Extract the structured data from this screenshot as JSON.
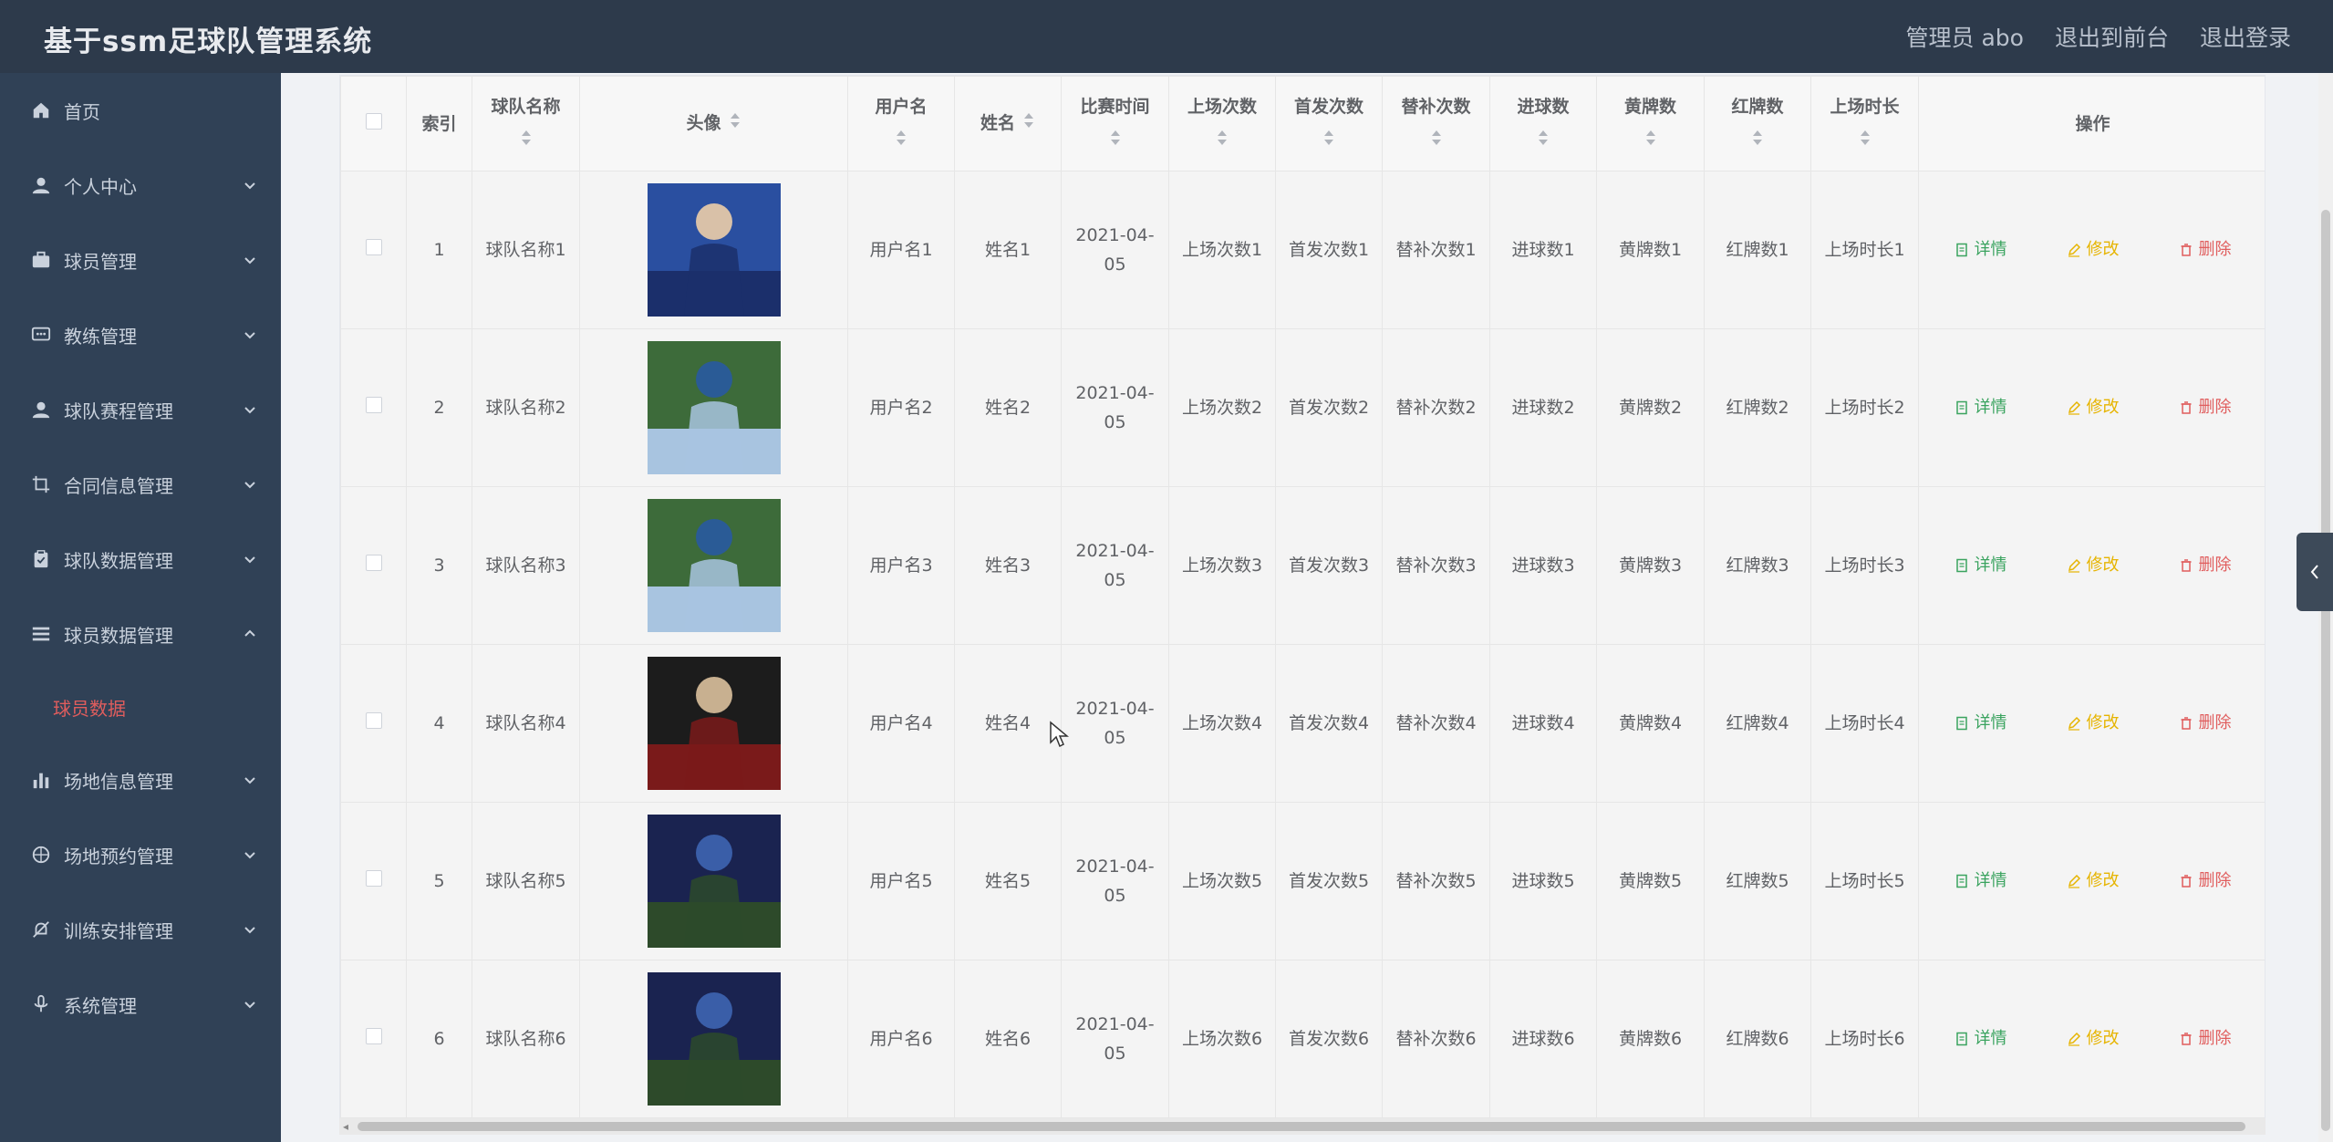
{
  "header": {
    "title": "基于ssm足球队管理系统",
    "admin_label": "管理员 abo",
    "front_label": "退出到前台",
    "logout_label": "退出登录"
  },
  "sidebar": {
    "items": [
      {
        "label": "首页",
        "icon": "home-icon"
      },
      {
        "label": "个人中心",
        "icon": "user-icon"
      },
      {
        "label": "球员管理",
        "icon": "briefcase-icon"
      },
      {
        "label": "教练管理",
        "icon": "chat-icon"
      },
      {
        "label": "球队赛程管理",
        "icon": "user-icon"
      },
      {
        "label": "合同信息管理",
        "icon": "crop-icon"
      },
      {
        "label": "球队数据管理",
        "icon": "clipboard-icon"
      },
      {
        "label": "球员数据管理",
        "icon": "list-icon"
      },
      {
        "label": "场地信息管理",
        "icon": "bar-chart-icon"
      },
      {
        "label": "场地预约管理",
        "icon": "globe-icon"
      },
      {
        "label": "训练安排管理",
        "icon": "bell-off-icon"
      },
      {
        "label": "系统管理",
        "icon": "mic-icon"
      }
    ],
    "active_sub": "球员数据"
  },
  "table": {
    "headers": {
      "index": "索引",
      "team": "球队名称",
      "avatar": "头像",
      "username": "用户名",
      "name": "姓名",
      "match_time": "比赛时间",
      "appearances": "上场次数",
      "starts": "首发次数",
      "subs": "替补次数",
      "goals": "进球数",
      "yellow": "黄牌数",
      "red": "红牌数",
      "minutes": "上场时长",
      "ops": "操作"
    },
    "ops": {
      "detail": "详情",
      "edit": "修改",
      "delete": "删除"
    },
    "rows": [
      {
        "index": "1",
        "team": "球队名称1",
        "username": "用户名1",
        "name": "姓名1",
        "match_time": "2021-04-05",
        "appearances": "上场次数1",
        "starts": "首发次数1",
        "subs": "替补次数1",
        "goals": "进球数1",
        "yellow": "黄牌数1",
        "red": "红牌数1",
        "minutes": "上场时长1"
      },
      {
        "index": "2",
        "team": "球队名称2",
        "username": "用户名2",
        "name": "姓名2",
        "match_time": "2021-04-05",
        "appearances": "上场次数2",
        "starts": "首发次数2",
        "subs": "替补次数2",
        "goals": "进球数2",
        "yellow": "黄牌数2",
        "red": "红牌数2",
        "minutes": "上场时长2"
      },
      {
        "index": "3",
        "team": "球队名称3",
        "username": "用户名3",
        "name": "姓名3",
        "match_time": "2021-04-05",
        "appearances": "上场次数3",
        "starts": "首发次数3",
        "subs": "替补次数3",
        "goals": "进球数3",
        "yellow": "黄牌数3",
        "red": "红牌数3",
        "minutes": "上场时长3"
      },
      {
        "index": "4",
        "team": "球队名称4",
        "username": "用户名4",
        "name": "姓名4",
        "match_time": "2021-04-05",
        "appearances": "上场次数4",
        "starts": "首发次数4",
        "subs": "替补次数4",
        "goals": "进球数4",
        "yellow": "黄牌数4",
        "red": "红牌数4",
        "minutes": "上场时长4"
      },
      {
        "index": "5",
        "team": "球队名称5",
        "username": "用户名5",
        "name": "姓名5",
        "match_time": "2021-04-05",
        "appearances": "上场次数5",
        "starts": "首发次数5",
        "subs": "替补次数5",
        "goals": "进球数5",
        "yellow": "黄牌数5",
        "red": "红牌数5",
        "minutes": "上场时长5"
      },
      {
        "index": "6",
        "team": "球队名称6",
        "username": "用户名6",
        "name": "姓名6",
        "match_time": "2021-04-05",
        "appearances": "上场次数6",
        "starts": "首发次数6",
        "subs": "替补次数6",
        "goals": "进球数6",
        "yellow": "黄牌数6",
        "red": "红牌数6",
        "minutes": "上场时长6"
      }
    ]
  },
  "colors": {
    "topbar": "#2d3a4b",
    "sidebar": "#304156",
    "detail": "#3aa35f",
    "edit": "#e6b400",
    "delete": "#e05d5d"
  }
}
